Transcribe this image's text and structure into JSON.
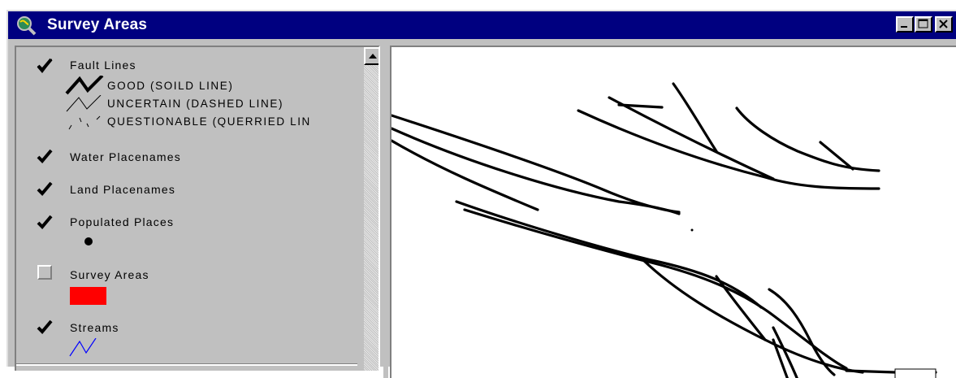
{
  "window": {
    "title": "Survey Areas"
  },
  "legend": {
    "layers": [
      {
        "name": "Fault Lines",
        "checked": true,
        "symbols": [
          {
            "label": "GOOD (SOILD LINE)",
            "style": "solid"
          },
          {
            "label": "UNCERTAIN (DASHED LINE)",
            "style": "dashed"
          },
          {
            "label": "QUESTIONABLE (QUERRIED LIN",
            "style": "queried"
          }
        ]
      },
      {
        "name": "Water Placenames",
        "checked": true
      },
      {
        "name": "Land Placenames",
        "checked": true
      },
      {
        "name": "Populated Places",
        "checked": true,
        "symbol": "black-dot"
      },
      {
        "name": "Survey Areas",
        "checked": false,
        "symbol": "red-rectangle",
        "color": "#ff0000"
      },
      {
        "name": "Streams",
        "checked": true,
        "symbol": "blue-zigzag",
        "color": "#0000ff"
      }
    ]
  },
  "colors": {
    "titlebar": "#000080",
    "face": "#c0c0c0",
    "survey_area_fill": "#ff0000",
    "stream_line": "#0000ff"
  }
}
